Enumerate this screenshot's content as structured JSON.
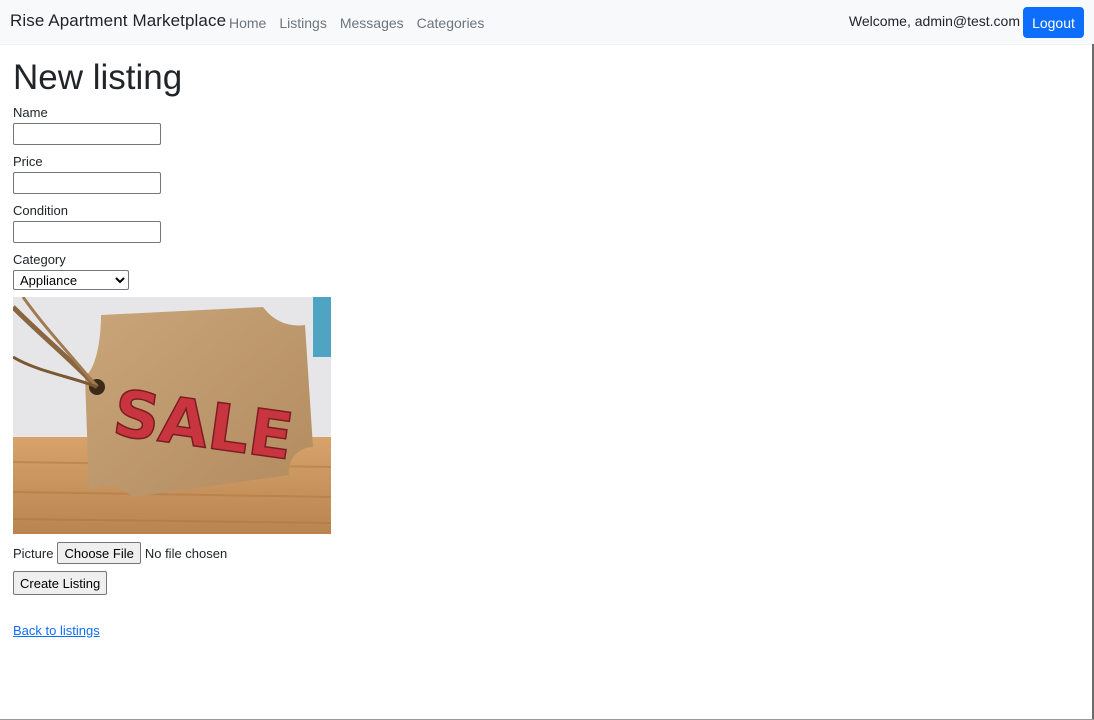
{
  "navbar": {
    "brand": "Rise Apartment Marketplace",
    "links": [
      "Home",
      "Listings",
      "Messages",
      "Categories"
    ],
    "welcome": "Welcome, admin@test.com",
    "logout_label": "Logout"
  },
  "page": {
    "title": "New listing"
  },
  "form": {
    "name_label": "Name",
    "name_value": "",
    "price_label": "Price",
    "price_value": "",
    "condition_label": "Condition",
    "condition_value": "",
    "category_label": "Category",
    "category_selected": "Appliance",
    "picture_label": "Picture",
    "file_button_label": "Choose File",
    "file_status": "No file chosen",
    "submit_label": "Create Listing"
  },
  "preview": {
    "tag_text": "SALE"
  },
  "back_link": "Back to listings",
  "colors": {
    "primary": "#0d6efd",
    "navbar_bg": "#f8f9fa",
    "muted_link": "#6c757d",
    "sale_red": "#c9353f",
    "tag_brown": "#c19a6b"
  }
}
